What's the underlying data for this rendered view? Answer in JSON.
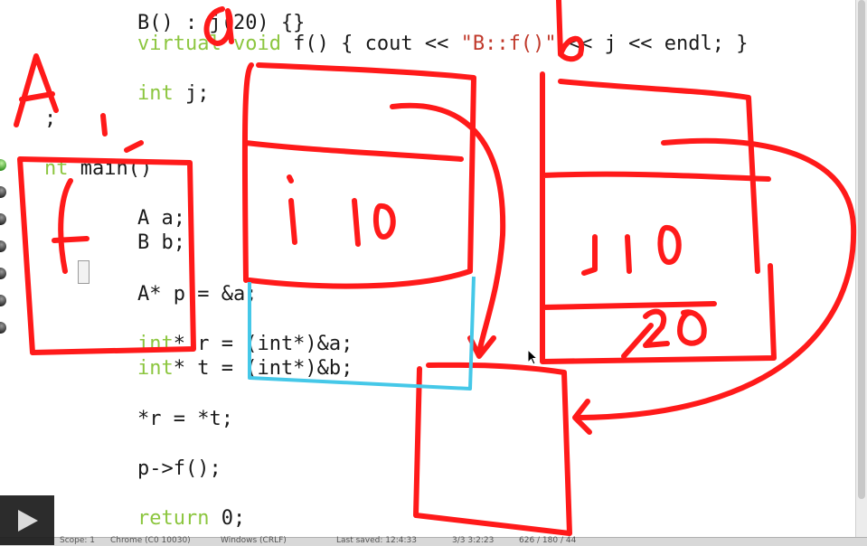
{
  "code": {
    "line_top": {
      "pre": "B() : j(20) {}"
    },
    "line_virtual": {
      "kw1": "virtual ",
      "kw2": "void",
      "mid": " f() { cout << ",
      "str": "\"B::f()\"",
      "tail": " << j << endl; }"
    },
    "line_int_j": {
      "kw": "int",
      "rest": " j;"
    },
    "line_brace": {
      "text": ";"
    },
    "line_main": {
      "kw": "nt",
      "rest": " main()"
    },
    "line_a": {
      "text": "A a;"
    },
    "line_b": {
      "text": "B b;"
    },
    "line_p": {
      "text": "A* p = &a;"
    },
    "line_r": {
      "kw": "int",
      "rest": "* r = (int*)&a;"
    },
    "line_t": {
      "kw": "int",
      "rest": "* t = (int*)&b;"
    },
    "line_assign": {
      "text": "*r = *t;"
    },
    "line_call": {
      "text": "p->f();"
    },
    "line_return": {
      "kw": "return",
      "rest": " 0;"
    }
  },
  "annotations": {
    "label_A": "A",
    "label_a": "a",
    "label_b": "b",
    "box_a_field": "i 10",
    "box_b_field": "j 10",
    "box_b_extra": "20"
  },
  "status_bar": {
    "items": [
      "Scope: 1",
      "Chrome (C0 10030)",
      "Windows (CRLF)",
      "Last saved: 12:4:33",
      "3/3 3:2:23",
      "626 / 180 / 44"
    ]
  },
  "colors": {
    "ink_red": "#ff1a1a",
    "ink_cyan": "#45c8e8",
    "keyword_green": "#8cc63f"
  },
  "icons": {
    "play": "play-icon",
    "pointer": "mouse-pointer-icon",
    "breakpoint": "breakpoint-dot-icon"
  }
}
